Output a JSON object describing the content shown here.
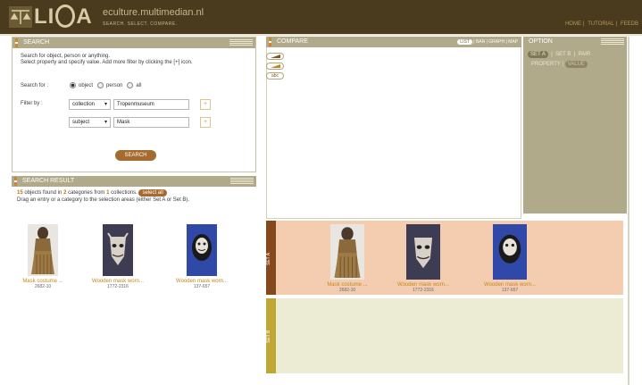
{
  "header": {
    "logo_word": "LISA",
    "site_url": "eculture.multimedian.nl",
    "tagline": "SEARCH. SELECT. COMPARE.",
    "nav": [
      "HOME",
      "TUTORIAL",
      "FEEDB"
    ]
  },
  "search": {
    "title": "SEARCH",
    "help_line1": "Search for object, person or anything.",
    "help_line2": "Select property and specify value. Add more filter by clicking the [+] icon.",
    "search_for_label": "Search for :",
    "options": [
      "object",
      "person",
      "all"
    ],
    "selected_option": "object",
    "filter_label": "Filter by :",
    "filters": [
      {
        "property": "collection",
        "value": "Tropenmuseum"
      },
      {
        "property": "subject",
        "value": "Mask"
      }
    ],
    "plus_label": "[+]",
    "button_label": "SEARCH"
  },
  "results": {
    "title": "SEARCH RESULT",
    "count": "15",
    "count_suffix": " objects found in ",
    "categories": "2",
    "categories_suffix": " categories from ",
    "collections": "1",
    "collections_suffix": " collections.",
    "select_all": "select all",
    "instruction": "Drag an entry or a category to the selection areas (either Set A or Set B).",
    "items": [
      {
        "caption": "Mask costume ...",
        "id": "2682-10"
      },
      {
        "caption": "Wooden mask worn...",
        "id": "1772-2316"
      },
      {
        "caption": "Wooden mask worn...",
        "id": "137-657"
      }
    ]
  },
  "compare": {
    "title": "COMPARE",
    "views": [
      "LIST",
      "BAR",
      "GRAPH",
      "MAP"
    ],
    "active_view": "LIST",
    "tools": [
      "sort-asc",
      "sort-desc",
      "abc"
    ],
    "abc_label": "abc"
  },
  "option": {
    "title": "OPTION",
    "tabs": [
      "SET A",
      "SET B",
      "PAIR"
    ],
    "active_tab": "SET A",
    "sub_tabs": [
      "PROPERTY",
      "VALUE"
    ],
    "active_sub_tab": "VALUE"
  },
  "sets": {
    "a_label": "SET A",
    "b_label": "SET B",
    "a_items": [
      {
        "caption": "Mask costume ...",
        "id": "2682-10"
      },
      {
        "caption": "Wooden mask worn...",
        "id": "1772-2316"
      },
      {
        "caption": "Wooden mask worn...",
        "id": "137-657"
      }
    ]
  },
  "colors": {
    "banner": "#4a3b1f",
    "panel_bar": "#b0a98a",
    "accent_button": "#a66a2f",
    "set_a_tab": "#86491e",
    "set_a_area": "#f4cdb1",
    "set_b_tab": "#bfa635",
    "set_b_area": "#ecebd4"
  }
}
